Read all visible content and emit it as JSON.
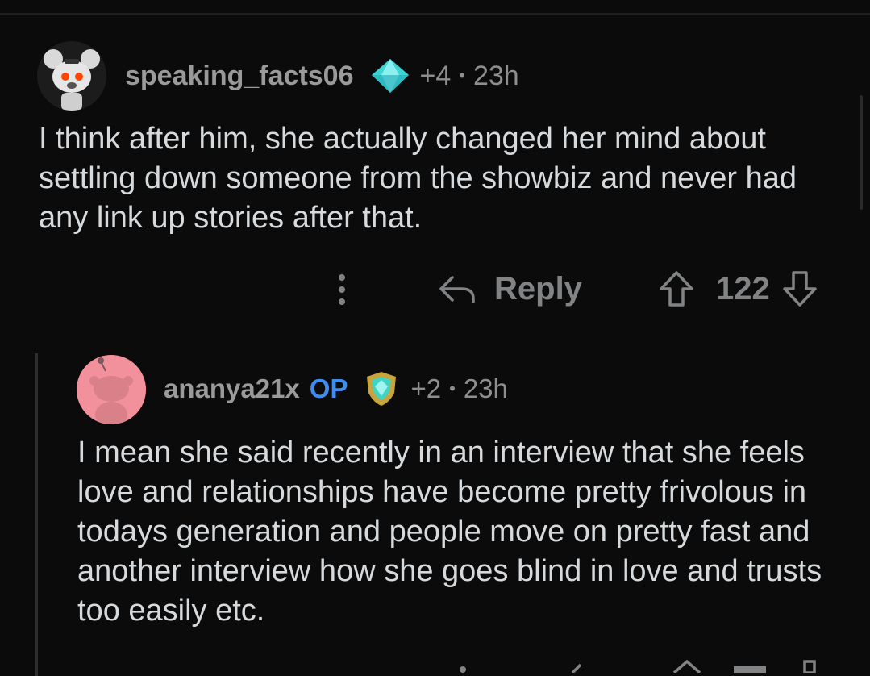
{
  "comment": {
    "username": "speaking_facts06",
    "karma_delta": "+4",
    "time": "23h",
    "body": "I think after him, she actually changed her mind about settling down someone from the showbiz and never had any link up stories after that.",
    "actions": {
      "reply_label": "Reply",
      "score": "122"
    },
    "award_icon": "diamond-award-icon"
  },
  "reply": {
    "username": "ananya21x",
    "op_badge": "OP",
    "karma_delta": "+2",
    "time": "23h",
    "body": "I mean she said recently in an interview that she feels love and relationships have become pretty frivolous in todays generation and people move on pretty fast and another interview how she goes blind in love and trusts too easily etc.",
    "avatar_color": "#f2919c",
    "award_icon": "gem-shield-award-icon"
  },
  "colors": {
    "background": "#0b0b0b",
    "text": "#d7dadc",
    "muted": "#8e8e8e",
    "op": "#3d8ef0"
  }
}
